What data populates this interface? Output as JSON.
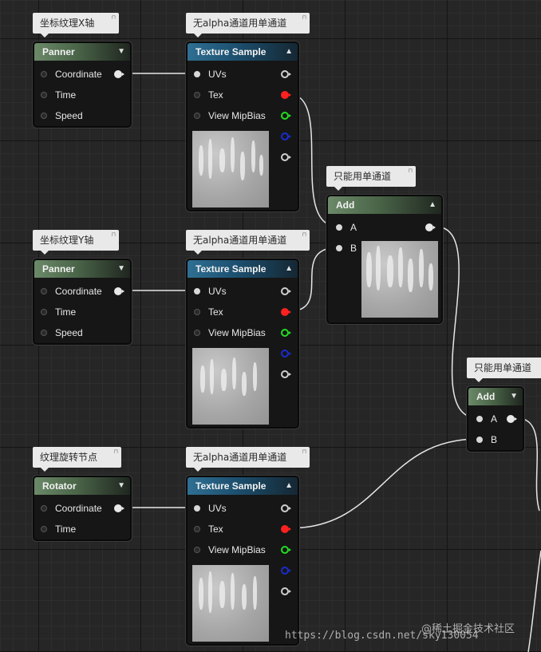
{
  "comments": {
    "panner_x": "坐标纹理X轴",
    "tex1": "无alpha通道用单通道",
    "add1": "只能用单通道",
    "panner_y": "坐标纹理Y轴",
    "tex2": "无alpha通道用单通道",
    "add2": "只能用单通道",
    "rotator": "纹理旋转节点",
    "tex3": "无alpha通道用单通道",
    "pin_icon": "⊓"
  },
  "panner": {
    "title": "Panner",
    "coordinate": "Coordinate",
    "time": "Time",
    "speed": "Speed"
  },
  "rotator": {
    "title": "Rotator",
    "coordinate": "Coordinate",
    "time": "Time"
  },
  "texture_sample": {
    "title": "Texture Sample",
    "uvs": "UVs",
    "tex": "Tex",
    "view_mip_bias": "View MipBias"
  },
  "add": {
    "title": "Add",
    "a": "A",
    "b": "B"
  },
  "glyphs": {
    "collapse_up": "▲",
    "collapse_down": "▼"
  },
  "colors": {
    "pin_white": "#e8e8e8",
    "pin_red": "#ff2020",
    "pin_green": "#22dd22",
    "pin_blue": "#1a2ccc",
    "pin_gray": "#cfcfcf",
    "wire": "#e6e6e6",
    "header_green": "#6b8a68",
    "header_blue": "#2f6f93"
  },
  "watermark": {
    "line1": "@稀土掘金技术社区",
    "line2": "https://blog.csdn.net/sky130054"
  }
}
